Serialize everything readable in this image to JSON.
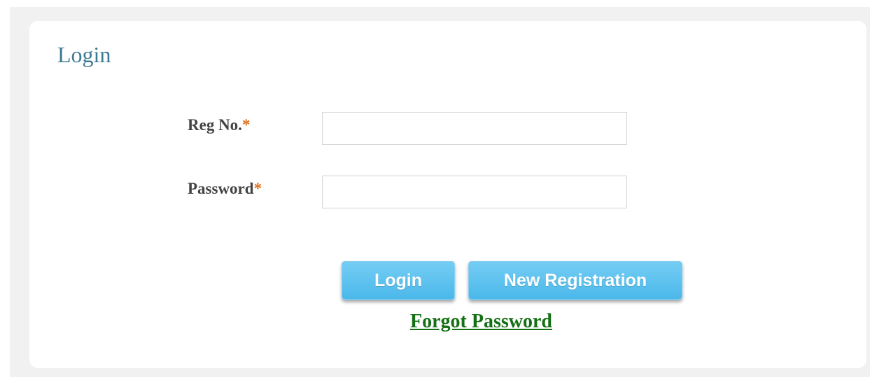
{
  "login_panel": {
    "title": "Login",
    "fields": {
      "reg_no": {
        "label": "Reg No.",
        "required_mark": "*",
        "value": ""
      },
      "password": {
        "label": "Password",
        "required_mark": "*",
        "value": ""
      }
    },
    "buttons": {
      "login": "Login",
      "new_registration": "New Registration"
    },
    "forgot_password_link": "Forgot Password"
  },
  "colors": {
    "title": "#3d7a93",
    "required_asterisk": "#e06b1a",
    "button": "#4ab8ea",
    "link": "#157015",
    "page_background": "#f1f1f1"
  }
}
